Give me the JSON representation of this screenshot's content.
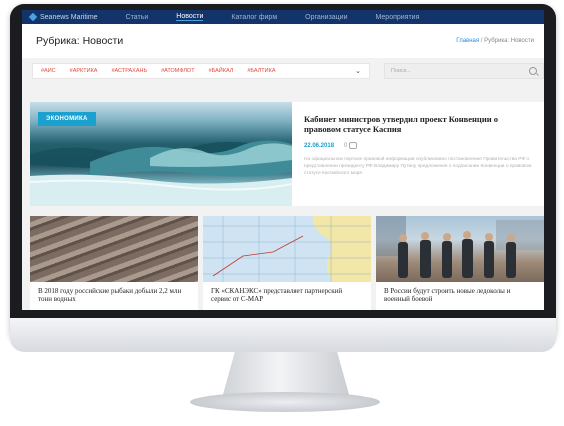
{
  "topnav": {
    "brand": "Seanews Maritime",
    "items": [
      "Статьи",
      "Новости",
      "Каталог фирм",
      "Организации",
      "Мероприятия"
    ],
    "active_index": 1
  },
  "rubric": {
    "title": "Рубрика: Новости",
    "breadcrumb_home": "Главная",
    "breadcrumb_sep": " / ",
    "breadcrumb_current": "Рубрика: Новости"
  },
  "tags": [
    "#АИС",
    "#АРКТИКА",
    "#АСТРАХАНЬ",
    "#АТОМФЛОТ",
    "#БАЙКАЛ",
    "#БАЛТИКА"
  ],
  "search": {
    "placeholder": "Поиск..."
  },
  "featured": {
    "category": "ЭКОНОМИКА",
    "title": "Кабинет министров утвердил проект Конвенции о правовом статусе Каспия",
    "date": "22.06.2018",
    "comments": "0",
    "lead": "На официальном портале правовой информации опубликовано постановление Правительства РФ о представлении президенту РФ Владимиру Путину предложения о подписании Конвенции о правовом статусе Каспийского моря."
  },
  "cards": [
    {
      "title": "В 2018 году российские рыбаки добыли 2,2 млн тонн водных",
      "image": "fish"
    },
    {
      "title": "ГК «СКАНЭКС» представляет партнерский сервис от C-MAP",
      "image": "map"
    },
    {
      "title": "В России будут строить новые ледоколы и военный боевой",
      "image": "people"
    }
  ],
  "colors": {
    "nav_bg": "#13346a",
    "accent": "#1ba1cf",
    "tag": "#e14a3c"
  }
}
